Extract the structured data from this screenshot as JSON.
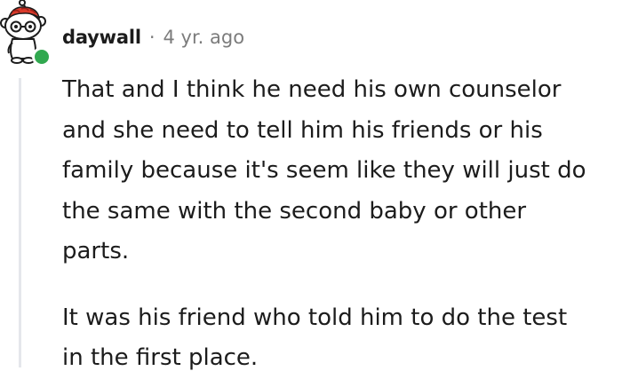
{
  "comment": {
    "username": "daywall",
    "separator": "·",
    "timestamp": "4 yr. ago",
    "paragraph_1_lines": [
      "That and I think he need his own counselor",
      "and she need to tell him his friends or his",
      "family because it's seem like they will just do",
      "the same with the second baby or other",
      "parts."
    ],
    "paragraph_2_lines": [
      "It was his friend who told him to do the test",
      "in the first place."
    ]
  },
  "colors": {
    "online_status": "#31a84f",
    "username": "#1c1c1c",
    "meta": "#7c7c7c",
    "thread_line": "#e5e7eb",
    "avatar_hat": "#d93a2b"
  },
  "icons": {
    "avatar": "snoo-avatar-icon",
    "status": "online-status-icon"
  }
}
